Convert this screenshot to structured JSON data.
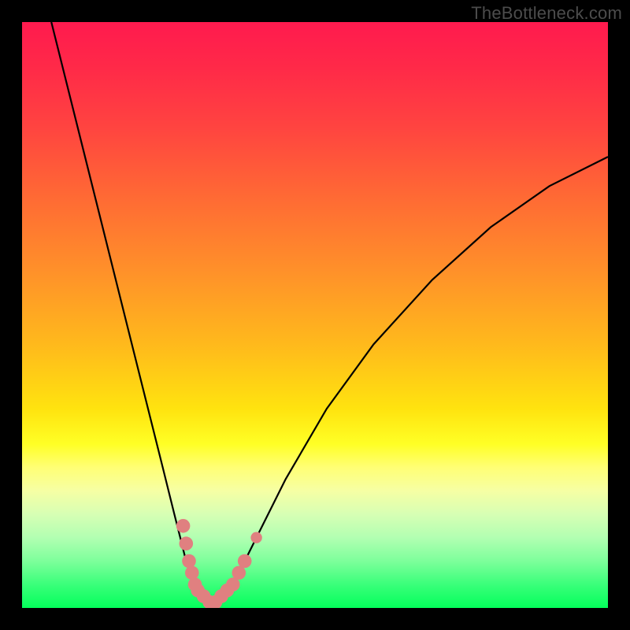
{
  "watermark": "TheBottleneck.com",
  "colors": {
    "frame": "#000000",
    "curve": "#000000",
    "marker": "#e08080",
    "gradient_top": "#ff1a4e",
    "gradient_mid": "#ffe30f",
    "gradient_bottom": "#04ff5b"
  },
  "chart_data": {
    "type": "line",
    "title": "",
    "xlabel": "",
    "ylabel": "",
    "xlim": [
      0,
      100
    ],
    "ylim": [
      0,
      100
    ],
    "grid": false,
    "legend": false,
    "series": [
      {
        "name": "curve",
        "x": [
          5,
          10,
          15,
          18,
          20,
          22,
          24,
          26,
          27,
          28,
          29,
          30,
          31,
          32,
          33,
          34,
          35,
          37,
          40,
          45,
          52,
          60,
          70,
          80,
          90,
          100
        ],
        "y": [
          100,
          80,
          60,
          48,
          40,
          32,
          24,
          16,
          12,
          8,
          5,
          3,
          2,
          1,
          1,
          2,
          3,
          6,
          12,
          22,
          34,
          45,
          56,
          65,
          72,
          77
        ]
      }
    ],
    "markers": [
      {
        "x": 27.5,
        "y": 14,
        "r": 2.2
      },
      {
        "x": 28.0,
        "y": 11,
        "r": 2.2
      },
      {
        "x": 28.5,
        "y": 8,
        "r": 2.2
      },
      {
        "x": 29.0,
        "y": 6,
        "r": 2.2
      },
      {
        "x": 29.5,
        "y": 4,
        "r": 2.2
      },
      {
        "x": 30.0,
        "y": 3,
        "r": 2.2
      },
      {
        "x": 31.0,
        "y": 2,
        "r": 2.2
      },
      {
        "x": 32.0,
        "y": 1,
        "r": 2.2
      },
      {
        "x": 33.0,
        "y": 1,
        "r": 2.2
      },
      {
        "x": 34.0,
        "y": 2,
        "r": 2.2
      },
      {
        "x": 35.0,
        "y": 3,
        "r": 2.2
      },
      {
        "x": 36.0,
        "y": 4,
        "r": 2.2
      },
      {
        "x": 37.0,
        "y": 6,
        "r": 2.2
      },
      {
        "x": 38.0,
        "y": 8,
        "r": 2.2
      },
      {
        "x": 40.0,
        "y": 12,
        "r": 1.8
      }
    ]
  }
}
